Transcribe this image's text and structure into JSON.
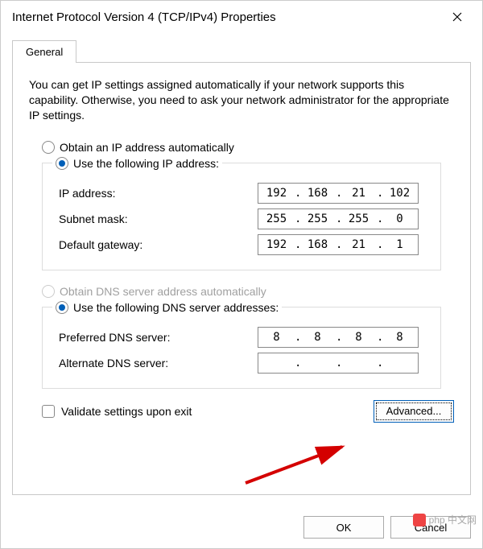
{
  "window": {
    "title": "Internet Protocol Version 4 (TCP/IPv4) Properties"
  },
  "tabs": {
    "general": "General"
  },
  "description": "You can get IP settings assigned automatically if your network supports this capability. Otherwise, you need to ask your network administrator for the appropriate IP settings.",
  "ip": {
    "auto_label": "Obtain an IP address automatically",
    "manual_label": "Use the following IP address:",
    "address_label": "IP address:",
    "address": {
      "o1": "192",
      "o2": "168",
      "o3": "21",
      "o4": "102"
    },
    "subnet_label": "Subnet mask:",
    "subnet": {
      "o1": "255",
      "o2": "255",
      "o3": "255",
      "o4": "0"
    },
    "gateway_label": "Default gateway:",
    "gateway": {
      "o1": "192",
      "o2": "168",
      "o3": "21",
      "o4": "1"
    }
  },
  "dns": {
    "auto_label": "Obtain DNS server address automatically",
    "manual_label": "Use the following DNS server addresses:",
    "preferred_label": "Preferred DNS server:",
    "preferred": {
      "o1": "8",
      "o2": "8",
      "o3": "8",
      "o4": "8"
    },
    "alternate_label": "Alternate DNS server:",
    "alternate": {
      "o1": "",
      "o2": "",
      "o3": "",
      "o4": ""
    }
  },
  "validate_label": "Validate settings upon exit",
  "buttons": {
    "advanced": "Advanced...",
    "ok": "OK",
    "cancel": "Cancel"
  },
  "watermark": "php 中文网"
}
